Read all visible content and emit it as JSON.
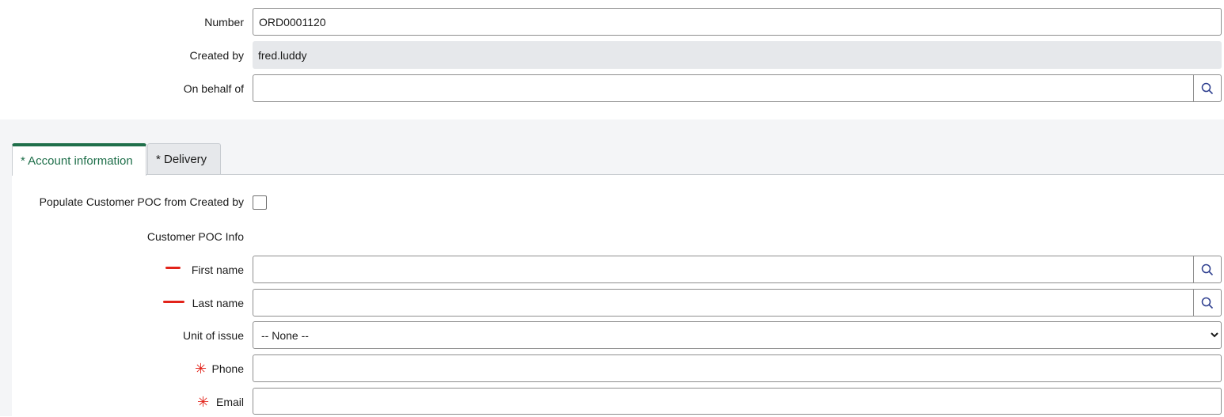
{
  "header_fields": {
    "number_label": "Number",
    "number_value": "ORD0001120",
    "created_by_label": "Created by",
    "created_by_value": "fred.luddy",
    "on_behalf_label": "On behalf of",
    "on_behalf_value": ""
  },
  "tabs": [
    {
      "label": "* Account information",
      "active": true
    },
    {
      "label": "* Delivery",
      "active": false
    }
  ],
  "account_info": {
    "populate_label": "Populate Customer POC from Created by",
    "populate_checked": false,
    "poc_info_label": "Customer POC Info",
    "first_name_label": "First name",
    "first_name_value": "",
    "last_name_label": "Last name",
    "last_name_value": "",
    "unit_label": "Unit of issue",
    "unit_selected": "-- None --",
    "phone_label": "Phone",
    "phone_value": "",
    "email_label": "Email",
    "email_value": ""
  },
  "icons": {
    "lookup": "search-icon",
    "required_filled": "required-bar",
    "required_mandatory": "asterisk"
  },
  "colors": {
    "accent": "#1f6f4a",
    "required": "#e2231a",
    "readonly_bg": "#e6e8eb",
    "section_bg": "#f4f5f7"
  }
}
